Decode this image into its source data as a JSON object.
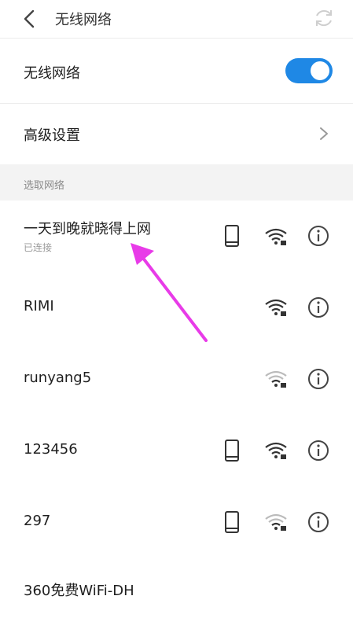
{
  "header": {
    "title": "无线网络",
    "back_icon": "chevron-left-icon",
    "refresh_icon": "refresh-icon"
  },
  "wifi_toggle": {
    "label": "无线网络",
    "state": "on",
    "color": "#1f88e5"
  },
  "advanced": {
    "label": "高级设置"
  },
  "section": {
    "title": "选取网络"
  },
  "networks": [
    {
      "name": "一天到晚就晓得上网",
      "status": "已连接",
      "phone": true,
      "signal": "strong"
    },
    {
      "name": "RIMI",
      "status": "",
      "phone": false,
      "signal": "strong"
    },
    {
      "name": "runyang5",
      "status": "",
      "phone": false,
      "signal": "weak"
    },
    {
      "name": "123456",
      "status": "",
      "phone": true,
      "signal": "strong"
    },
    {
      "name": "297",
      "status": "",
      "phone": true,
      "signal": "weak"
    },
    {
      "name": "360免费WiFi-DH",
      "status": "",
      "phone": false,
      "signal": "strong"
    }
  ],
  "accent_arrow_color": "#e83be8"
}
